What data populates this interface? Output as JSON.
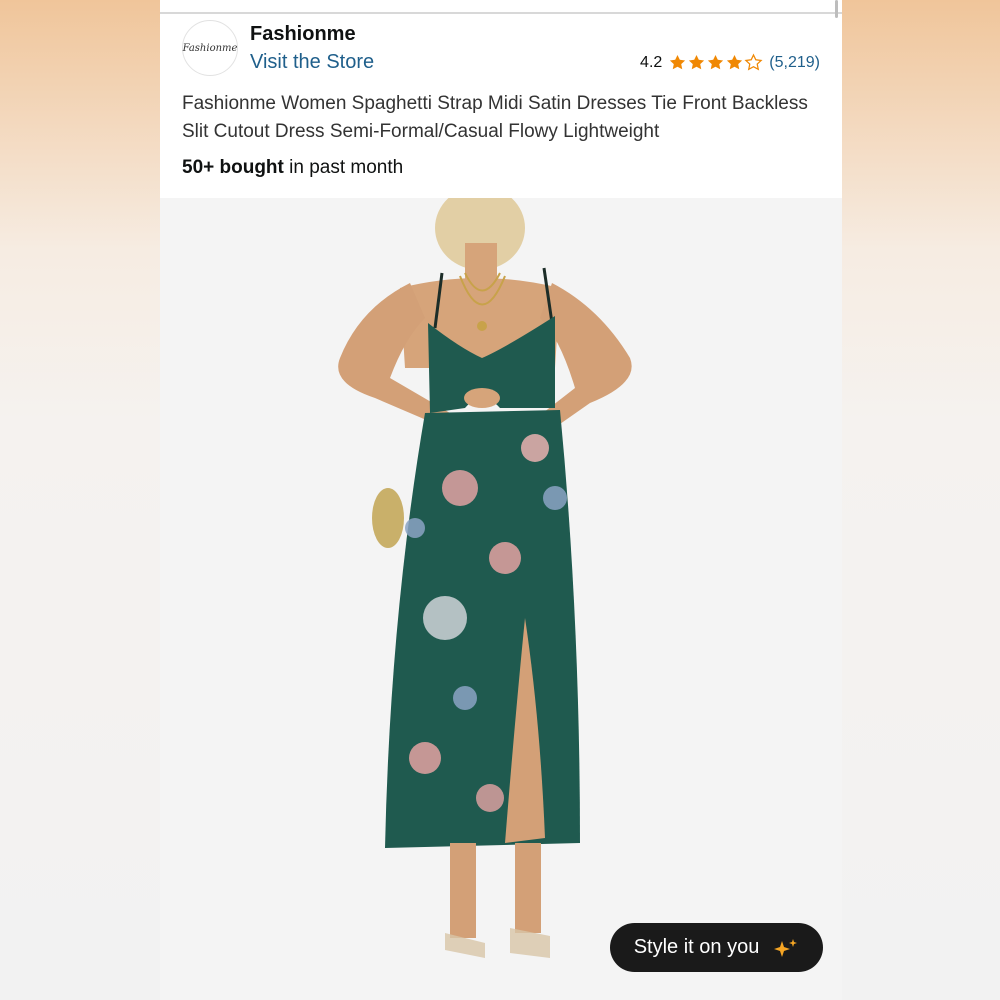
{
  "store": {
    "logo_text": "Fashionme",
    "name": "Fashionme",
    "visit_label": "Visit the Store"
  },
  "rating": {
    "value": "4.2",
    "stars": 4.2,
    "count": "(5,219)"
  },
  "product": {
    "title": "Fashionme Women Spaghetti Strap Midi Satin Dresses Tie Front Backless Slit Cutout Dress Semi-Formal/Casual Flowy Lightweight",
    "bought_bold": "50+ bought",
    "bought_rest": " in past month",
    "image_icon": "dress-photo"
  },
  "style_button": {
    "label": "Style it on you",
    "icon": "sparkle-icon"
  },
  "colors": {
    "link": "#1f5f8b",
    "star": "#f08804",
    "dress": "#1f5a4f",
    "button_bg": "#1a1a1a"
  }
}
